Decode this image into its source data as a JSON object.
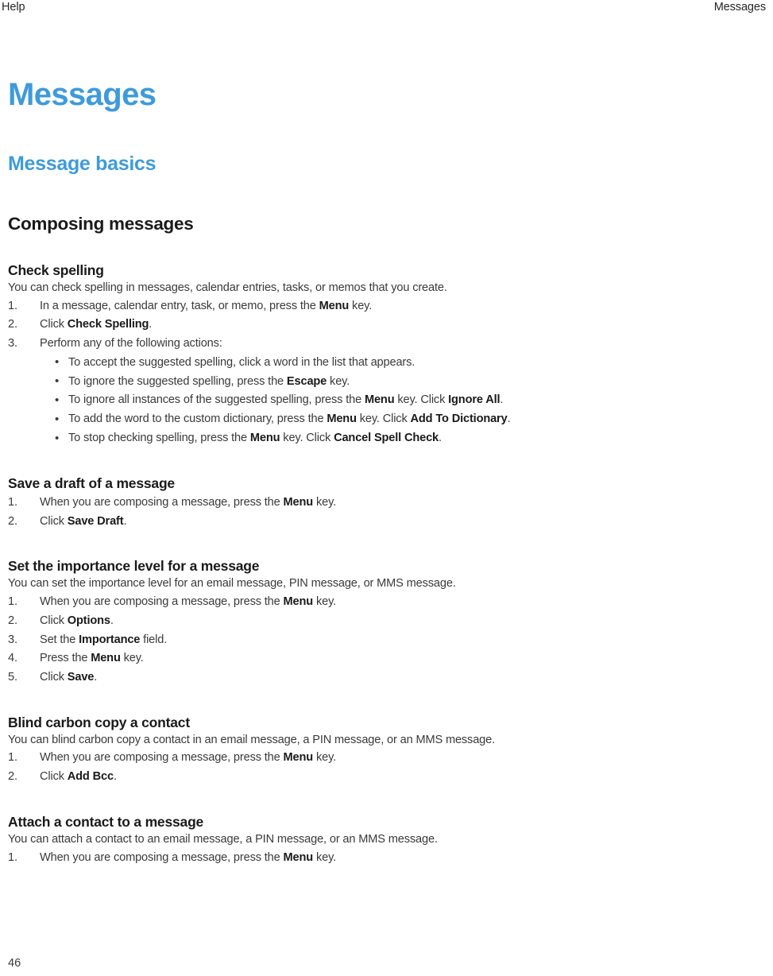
{
  "header": {
    "left": "Help",
    "right": "Messages"
  },
  "footer": {
    "page_number": "46"
  },
  "colors": {
    "heading_blue": "#3e9bdb",
    "body_text": "#3a3a3a",
    "strong_text": "#1a1a1a",
    "page_background": "#ffffff"
  },
  "doc": {
    "title": "Messages",
    "subtitle": "Message basics",
    "section_title": "Composing messages"
  },
  "topics": [
    {
      "title": "Check spelling",
      "intro": "You can check spelling in messages, calendar entries, tasks, or memos that you create.",
      "steps": [
        {
          "num": "1.",
          "parts": [
            {
              "t": "In a message, calendar entry, task, or memo, press the ",
              "b": false
            },
            {
              "t": "Menu",
              "b": true
            },
            {
              "t": " key.",
              "b": false
            }
          ]
        },
        {
          "num": "2.",
          "parts": [
            {
              "t": "Click ",
              "b": false
            },
            {
              "t": "Check Spelling",
              "b": true
            },
            {
              "t": ".",
              "b": false
            }
          ]
        },
        {
          "num": "3.",
          "parts": [
            {
              "t": "Perform any of the following actions:",
              "b": false
            }
          ],
          "substeps": [
            {
              "bullet": "•",
              "parts": [
                {
                  "t": "To accept the suggested spelling, click a word in the list that appears.",
                  "b": false
                }
              ]
            },
            {
              "bullet": "•",
              "parts": [
                {
                  "t": "To ignore the suggested spelling, press the ",
                  "b": false
                },
                {
                  "t": "Escape",
                  "b": true
                },
                {
                  "t": " key.",
                  "b": false
                }
              ]
            },
            {
              "bullet": "•",
              "parts": [
                {
                  "t": "To ignore all instances of the suggested spelling, press the ",
                  "b": false
                },
                {
                  "t": "Menu",
                  "b": true
                },
                {
                  "t": " key. Click ",
                  "b": false
                },
                {
                  "t": "Ignore All",
                  "b": true
                },
                {
                  "t": ".",
                  "b": false
                }
              ]
            },
            {
              "bullet": "•",
              "parts": [
                {
                  "t": "To add the word to the custom dictionary, press the ",
                  "b": false
                },
                {
                  "t": "Menu",
                  "b": true
                },
                {
                  "t": " key. Click ",
                  "b": false
                },
                {
                  "t": "Add To Dictionary",
                  "b": true
                },
                {
                  "t": ".",
                  "b": false
                }
              ]
            },
            {
              "bullet": "•",
              "parts": [
                {
                  "t": "To stop checking spelling, press the ",
                  "b": false
                },
                {
                  "t": "Menu",
                  "b": true
                },
                {
                  "t": " key. Click ",
                  "b": false
                },
                {
                  "t": "Cancel Spell Check",
                  "b": true
                },
                {
                  "t": ".",
                  "b": false
                }
              ]
            }
          ]
        }
      ]
    },
    {
      "title": "Save a draft of a message",
      "intro": null,
      "steps": [
        {
          "num": "1.",
          "parts": [
            {
              "t": "When you are composing a message, press the ",
              "b": false
            },
            {
              "t": "Menu",
              "b": true
            },
            {
              "t": " key.",
              "b": false
            }
          ]
        },
        {
          "num": "2.",
          "parts": [
            {
              "t": "Click ",
              "b": false
            },
            {
              "t": "Save Draft",
              "b": true
            },
            {
              "t": ".",
              "b": false
            }
          ]
        }
      ]
    },
    {
      "title": "Set the importance level for a message",
      "intro": "You can set the importance level for an email message, PIN message, or MMS message.",
      "steps": [
        {
          "num": "1.",
          "parts": [
            {
              "t": "When you are composing a message, press the ",
              "b": false
            },
            {
              "t": "Menu",
              "b": true
            },
            {
              "t": " key.",
              "b": false
            }
          ]
        },
        {
          "num": "2.",
          "parts": [
            {
              "t": "Click ",
              "b": false
            },
            {
              "t": "Options",
              "b": true
            },
            {
              "t": ".",
              "b": false
            }
          ]
        },
        {
          "num": "3.",
          "parts": [
            {
              "t": "Set the ",
              "b": false
            },
            {
              "t": "Importance",
              "b": true
            },
            {
              "t": " field.",
              "b": false
            }
          ]
        },
        {
          "num": "4.",
          "parts": [
            {
              "t": "Press the ",
              "b": false
            },
            {
              "t": "Menu",
              "b": true
            },
            {
              "t": " key.",
              "b": false
            }
          ]
        },
        {
          "num": "5.",
          "parts": [
            {
              "t": "Click ",
              "b": false
            },
            {
              "t": "Save",
              "b": true
            },
            {
              "t": ".",
              "b": false
            }
          ]
        }
      ]
    },
    {
      "title": "Blind carbon copy a contact",
      "intro": "You can blind carbon copy a contact in an email message, a PIN message, or an MMS message.",
      "steps": [
        {
          "num": "1.",
          "parts": [
            {
              "t": "When you are composing a message, press the ",
              "b": false
            },
            {
              "t": "Menu",
              "b": true
            },
            {
              "t": " key.",
              "b": false
            }
          ]
        },
        {
          "num": "2.",
          "parts": [
            {
              "t": "Click ",
              "b": false
            },
            {
              "t": "Add Bcc",
              "b": true
            },
            {
              "t": ".",
              "b": false
            }
          ]
        }
      ]
    },
    {
      "title": "Attach a contact to a message",
      "intro": "You can attach a contact to an email message, a PIN message, or an MMS message.",
      "steps": [
        {
          "num": "1.",
          "parts": [
            {
              "t": "When you are composing a message, press the ",
              "b": false
            },
            {
              "t": "Menu",
              "b": true
            },
            {
              "t": " key.",
              "b": false
            }
          ]
        }
      ]
    }
  ]
}
